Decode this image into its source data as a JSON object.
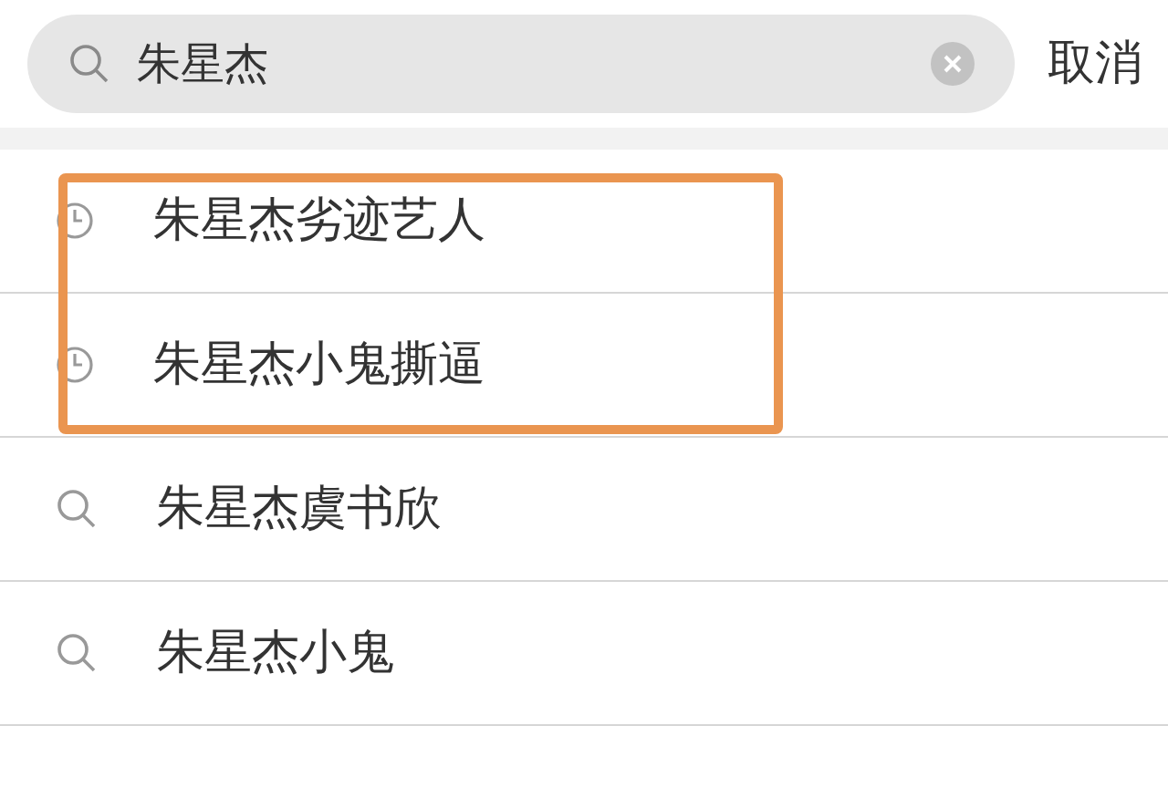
{
  "search": {
    "value": "朱星杰"
  },
  "cancel": "取消",
  "suggestions": [
    {
      "kind": "history",
      "text": "朱星杰劣迹艺人",
      "highlighted": true
    },
    {
      "kind": "history",
      "text": "朱星杰小鬼撕逼",
      "highlighted": true
    },
    {
      "kind": "search",
      "text": "朱星杰虞书欣",
      "highlighted": false
    },
    {
      "kind": "search",
      "text": "朱星杰小鬼",
      "highlighted": false
    }
  ]
}
